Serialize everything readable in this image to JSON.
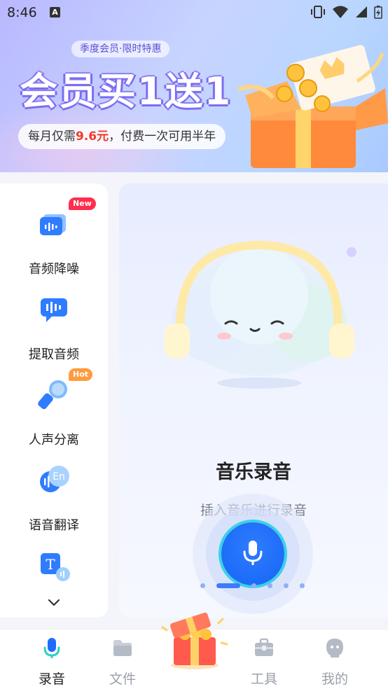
{
  "status_bar": {
    "time": "8:46",
    "notification_icon_letter": "A"
  },
  "banner": {
    "pill_text": "季度会员·限时特惠",
    "title": "会员买1送1",
    "subtitle_pre": "每月仅需",
    "subtitle_price": "9.6元",
    "subtitle_post": "，付费一次可用半年"
  },
  "side_menu": {
    "items": [
      {
        "label": "音频降噪",
        "icon": "audio-denoise-icon",
        "badge": "New"
      },
      {
        "label": "提取音频",
        "icon": "extract-audio-icon",
        "badge": ""
      },
      {
        "label": "人声分离",
        "icon": "microphone-icon",
        "badge": "Hot"
      },
      {
        "label": "语音翻译",
        "icon": "voice-translate-icon",
        "badge": "",
        "icon_text": "En"
      },
      {
        "label": "",
        "icon": "text-speech-icon",
        "icon_text": "T"
      }
    ]
  },
  "main_card": {
    "title": "音乐录音",
    "subtitle": "插入音乐进行录音",
    "pager": {
      "pages": 6,
      "active_index": 0
    }
  },
  "bottom_nav": {
    "items": [
      {
        "label": "录音",
        "icon": "mic-icon",
        "active": true
      },
      {
        "label": "文件",
        "icon": "folder-icon",
        "active": false
      },
      {
        "label": "工具",
        "icon": "toolbox-icon",
        "active": false
      },
      {
        "label": "我的",
        "icon": "profile-icon",
        "active": false
      }
    ]
  },
  "colors": {
    "accent": "#1565f5",
    "new_badge": "#ff2e4d",
    "hot_badge": "#ff9b3d",
    "price_red": "#f03a2e"
  }
}
